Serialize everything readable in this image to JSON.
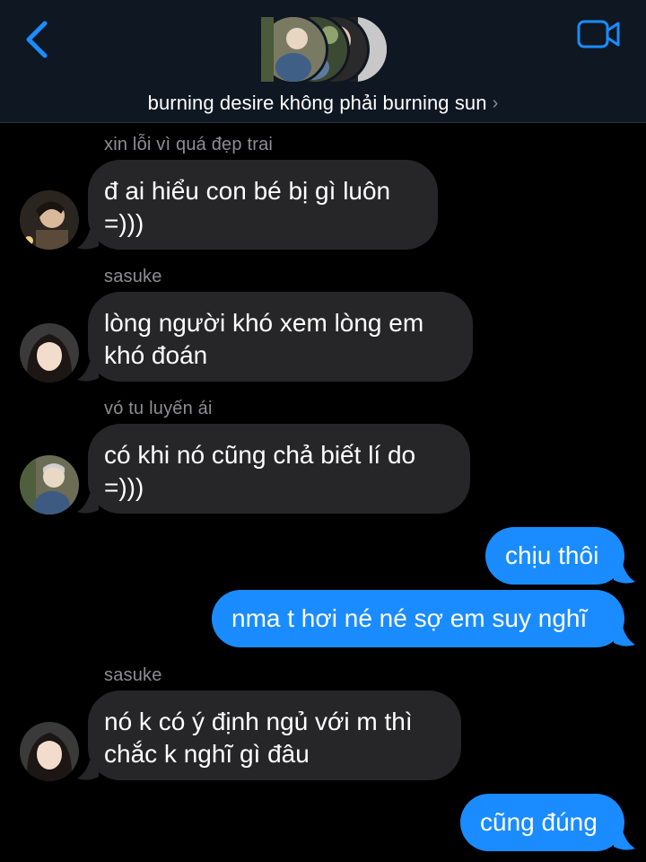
{
  "header": {
    "title": "burning desire không phải burning sun",
    "back_icon": "chevron-left-icon",
    "video_icon": "video-camera-icon",
    "accent": "#1a8cff"
  },
  "messages": [
    {
      "direction": "incoming",
      "sender": "xin lỗi vì quá đẹp trai",
      "lines": [
        "đ ai hiểu con bé bị gì luôn",
        "=)))"
      ]
    },
    {
      "direction": "incoming",
      "sender": "sasuke",
      "lines": [
        "lòng người khó xem lòng em",
        "khó đoán"
      ]
    },
    {
      "direction": "incoming",
      "sender": "vó tu luyến ái",
      "lines": [
        "có khi nó cũng chả biết lí do",
        "=)))"
      ]
    },
    {
      "direction": "outgoing",
      "lines": [
        "chịu thôi"
      ]
    },
    {
      "direction": "outgoing",
      "lines": [
        "nma t hơi né né sợ em suy nghĩ"
      ]
    },
    {
      "direction": "incoming",
      "sender": "sasuke",
      "lines": [
        "nó k có ý định ngủ với m thì",
        "chắc k nghĩ gì đâu"
      ]
    },
    {
      "direction": "outgoing",
      "lines": [
        "cũng đúng"
      ]
    }
  ],
  "colors": {
    "incoming_bubble": "#262628",
    "outgoing_bubble": "#1a8cff",
    "sender_name": "#8e8e93",
    "header_bg": "#0f1722"
  }
}
